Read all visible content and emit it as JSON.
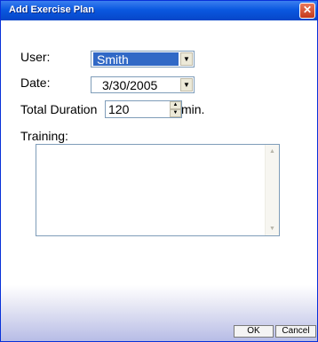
{
  "window": {
    "title": "Add Exercise Plan",
    "close_glyph": "✕"
  },
  "form": {
    "user_label": "User:",
    "user_value": "Smith",
    "date_label": "Date:",
    "date_value": "3/30/2005",
    "duration_label": "Total Duration",
    "duration_value": "120",
    "duration_unit": "min.",
    "training_label": "Training:",
    "training_value": ""
  },
  "buttons": {
    "ok": "OK",
    "cancel": "Cancel"
  },
  "icons": {
    "dropdown": "chevron-down-icon",
    "spin_up": "chevron-up-icon",
    "spin_down": "chevron-down-icon",
    "scroll_up": "scroll-up-icon",
    "scroll_down": "scroll-down-icon",
    "close": "close-icon"
  },
  "colors": {
    "titlebar": "#0a58e0",
    "selection": "#3169c6",
    "close": "#c4391b"
  }
}
